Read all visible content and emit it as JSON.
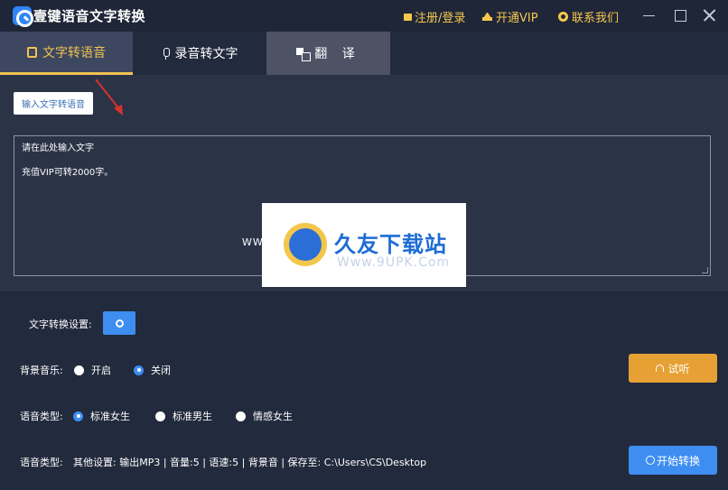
{
  "titlebar": {
    "app_title": "壹键语音文字转换",
    "register": "注册/登录",
    "vip": "开通VIP",
    "contact": "联系我们"
  },
  "tabs": [
    {
      "label": "文字转语音",
      "active": true
    },
    {
      "label": "录音转文字",
      "active": false
    },
    {
      "label": "翻 译",
      "active": false
    }
  ],
  "input_button": "输入文字转语音",
  "textarea": {
    "line1": "请在此处输入文字",
    "line2": "充值VIP可转2000字。"
  },
  "watermark": {
    "title": "久友下载站",
    "url": "Www.9UPK.Com",
    "www_text": "WWW.9UPK.COM"
  },
  "settings": {
    "conversion_label": "文字转换设置:",
    "bg_music_label": "背景音乐:",
    "bg_music_options": [
      {
        "label": "开启",
        "selected": false
      },
      {
        "label": "关闭",
        "selected": true
      }
    ],
    "voice_type_label": "语音类型:",
    "voice_options": [
      {
        "label": "标准女生",
        "selected": true
      },
      {
        "label": "标准男生",
        "selected": false
      },
      {
        "label": "情感女生",
        "selected": false
      }
    ],
    "summary_label": "语音类型:",
    "summary_text": "其他设置:   输出MP3 | 音量:5 | 语速:5 | 背景音 | 保存至: C:\\Users\\CS\\Desktop"
  },
  "buttons": {
    "listen": "试听",
    "start": "开始转换"
  },
  "colors": {
    "accent_gold": "#f0c351",
    "primary_blue": "#3d8ef0",
    "listen_orange": "#e6a034",
    "background": "#222a3d"
  }
}
